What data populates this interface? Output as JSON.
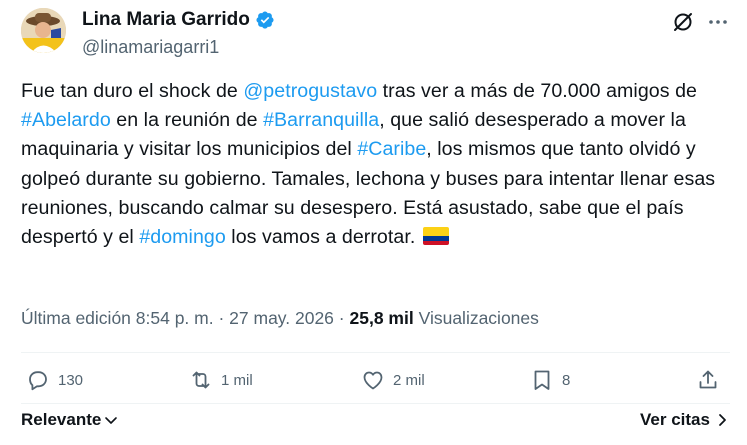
{
  "author": {
    "name": "Lina Maria Garrido",
    "handle": "@linamariagarri1",
    "verified": true
  },
  "tweet": {
    "segments": [
      {
        "text": "Fue tan duro el shock de ",
        "link": false
      },
      {
        "text": "@petrogustavo",
        "link": true
      },
      {
        "text": " tras ver a más de 70.000 amigos de ",
        "link": false
      },
      {
        "text": "#Abelardo",
        "link": true
      },
      {
        "text": " en la reunión de ",
        "link": false
      },
      {
        "text": "#Barranquilla",
        "link": true
      },
      {
        "text": ", que salió desesperado a mover la maquinaria y visitar los municipios del ",
        "link": false
      },
      {
        "text": "#Caribe",
        "link": true
      },
      {
        "text": ", los mismos que tanto olvidó y golpeó durante su gobierno. Tamales, lechona y buses para intentar llenar esas reuniones, buscando calmar su desespero. Está asustado, sabe que el país despertó y el ",
        "link": false
      },
      {
        "text": "#domingo",
        "link": true
      },
      {
        "text": " los vamos a derrotar. ",
        "link": false
      }
    ],
    "emoji": "colombia-flag"
  },
  "meta": {
    "edited_label": "Última edición 8:54 p. m.",
    "separator": "·",
    "date": "27 may. 2026",
    "views_count": "25,8 mil",
    "views_label": "Visualizaciones"
  },
  "actions": {
    "replies": "130",
    "reposts": "1 mil",
    "likes": "2 mil",
    "bookmarks": "8"
  },
  "footer": {
    "sort_label": "Relevante",
    "quotes_label": "Ver citas"
  },
  "colors": {
    "link": "#1d9bf0",
    "muted": "#536471",
    "text": "#0f1419",
    "flag_yellow": "#fcd116",
    "flag_blue": "#003893",
    "flag_red": "#ce1126"
  }
}
